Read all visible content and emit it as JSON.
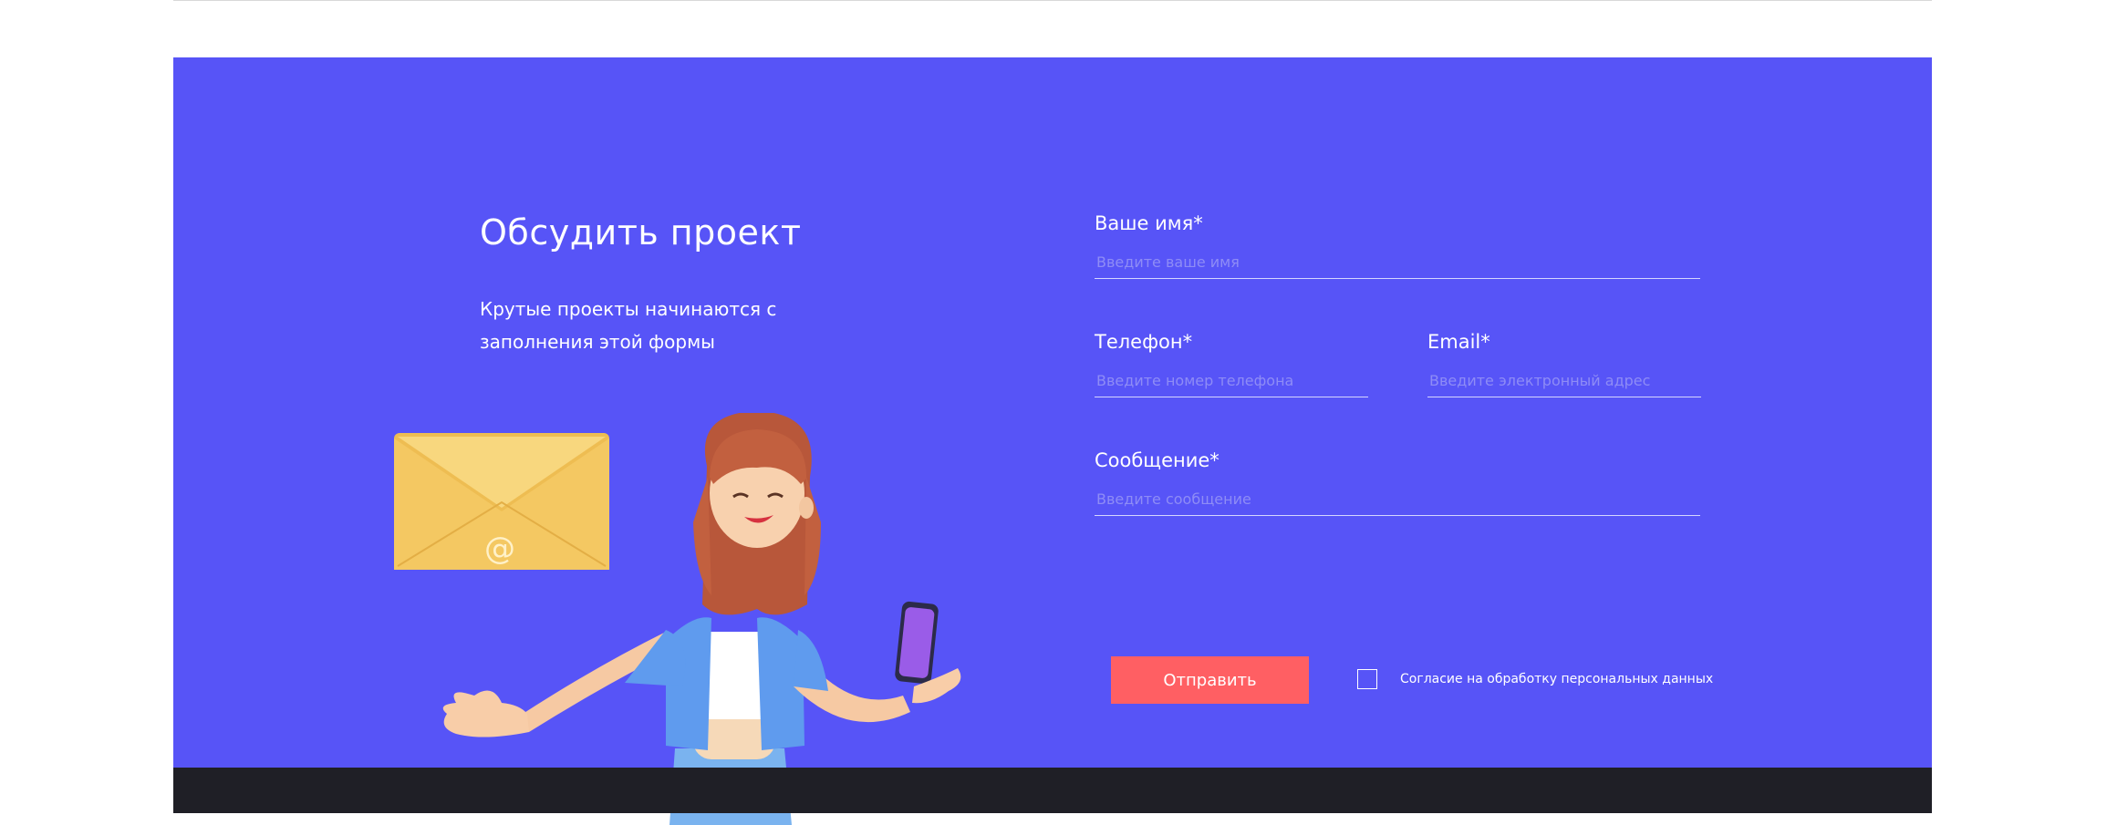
{
  "section": {
    "title": "Обсудить проект",
    "subtitle": "Крутые проекты начинаются с заполнения этой формы"
  },
  "form": {
    "name": {
      "label": "Ваше имя*",
      "placeholder": "Введите ваше имя"
    },
    "phone": {
      "label": "Телефон*",
      "placeholder": "Введите номер телефона"
    },
    "email": {
      "label": "Email*",
      "placeholder": "Введите электронный адрес"
    },
    "message": {
      "label": "Сообщение*",
      "placeholder": "Введите сообщение"
    },
    "submit_label": "Отправить",
    "consent_label": "Согласие на обработку персональных данных",
    "consent_checked": false
  },
  "illustration": {
    "envelope_symbol": "@",
    "icons": [
      "envelope-icon",
      "girl-with-phone-illustration"
    ]
  },
  "colors": {
    "hero_bg": "#5754f7",
    "button_bg": "#ff5f63",
    "footer_bg": "#1f1f26",
    "envelope": "#f2c45c"
  }
}
